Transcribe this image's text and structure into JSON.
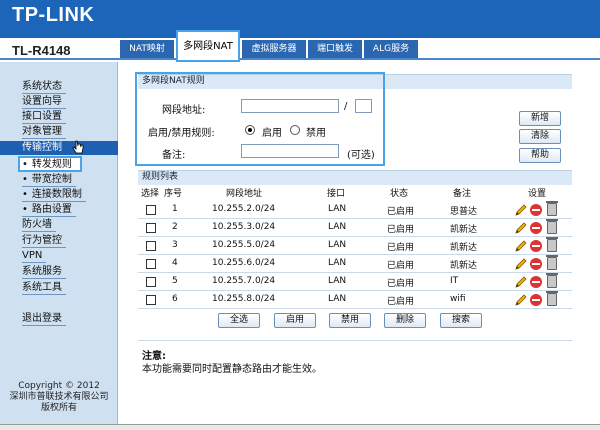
{
  "brand": {
    "logo": "TP-LINK",
    "model": "TL-R4148"
  },
  "tabs": [
    {
      "label": "NAT映射"
    },
    {
      "label": "多网段NAT"
    },
    {
      "label": "虚拟服务器"
    },
    {
      "label": "端口触发"
    },
    {
      "label": "ALG服务"
    }
  ],
  "sidebar": {
    "items": [
      {
        "label": "系统状态"
      },
      {
        "label": "设置向导"
      },
      {
        "label": "接口设置"
      },
      {
        "label": "对象管理"
      },
      {
        "label": "传输控制"
      },
      {
        "label": "转发规则"
      },
      {
        "label": "带宽控制"
      },
      {
        "label": "连接数限制"
      },
      {
        "label": "路由设置"
      },
      {
        "label": "防火墙"
      },
      {
        "label": "行为管控"
      },
      {
        "label": "VPN"
      },
      {
        "label": "系统服务"
      },
      {
        "label": "系统工具"
      },
      {
        "label": "退出登录"
      }
    ],
    "copyright": [
      "Copyright © 2012",
      "深圳市普联技术有限公司",
      "版权所有"
    ]
  },
  "rule_section": {
    "title": "多网段NAT规则",
    "subnet_label": "网段地址:",
    "subnet_sep": "/",
    "subnet_value": "",
    "mask_value": "",
    "enable_label": "启用/禁用规则:",
    "enable_option": "启用",
    "disable_option": "禁用",
    "enabled": true,
    "remark_label": "备注:",
    "remark_value": "",
    "optional_hint": "(可选)"
  },
  "side_buttons": [
    "新增",
    "清除",
    "帮助"
  ],
  "list_section": {
    "title": "规则列表",
    "headers": [
      "选择",
      "序号",
      "网段地址",
      "接口",
      "状态",
      "备注",
      "设置"
    ],
    "rows": [
      {
        "no": "1",
        "subnet": "10.255.2.0/24",
        "iface": "LAN",
        "status": "已启用",
        "remark": "思普达"
      },
      {
        "no": "2",
        "subnet": "10.255.3.0/24",
        "iface": "LAN",
        "status": "已启用",
        "remark": "凯新达"
      },
      {
        "no": "3",
        "subnet": "10.255.5.0/24",
        "iface": "LAN",
        "status": "已启用",
        "remark": "凯新达"
      },
      {
        "no": "4",
        "subnet": "10.255.6.0/24",
        "iface": "LAN",
        "status": "已启用",
        "remark": "凯新达"
      },
      {
        "no": "5",
        "subnet": "10.255.7.0/24",
        "iface": "LAN",
        "status": "已启用",
        "remark": "IT"
      },
      {
        "no": "6",
        "subnet": "10.255.8.0/24",
        "iface": "LAN",
        "status": "已启用",
        "remark": "wifi"
      }
    ]
  },
  "bottom_buttons": [
    "全选",
    "启用",
    "禁用",
    "删除",
    "搜索"
  ],
  "note": {
    "title": "注意:",
    "text": "本功能需要同时配置静态路由才能生效。"
  },
  "colors": {
    "brand_blue": "#1d65b8",
    "highlight": "#4aa3e6",
    "sidebar_bg": "#cfe1f1"
  },
  "icons": [
    "edit-pencil-icon",
    "disable-icon",
    "delete-trash-icon",
    "mouse-cursor-icon"
  ]
}
